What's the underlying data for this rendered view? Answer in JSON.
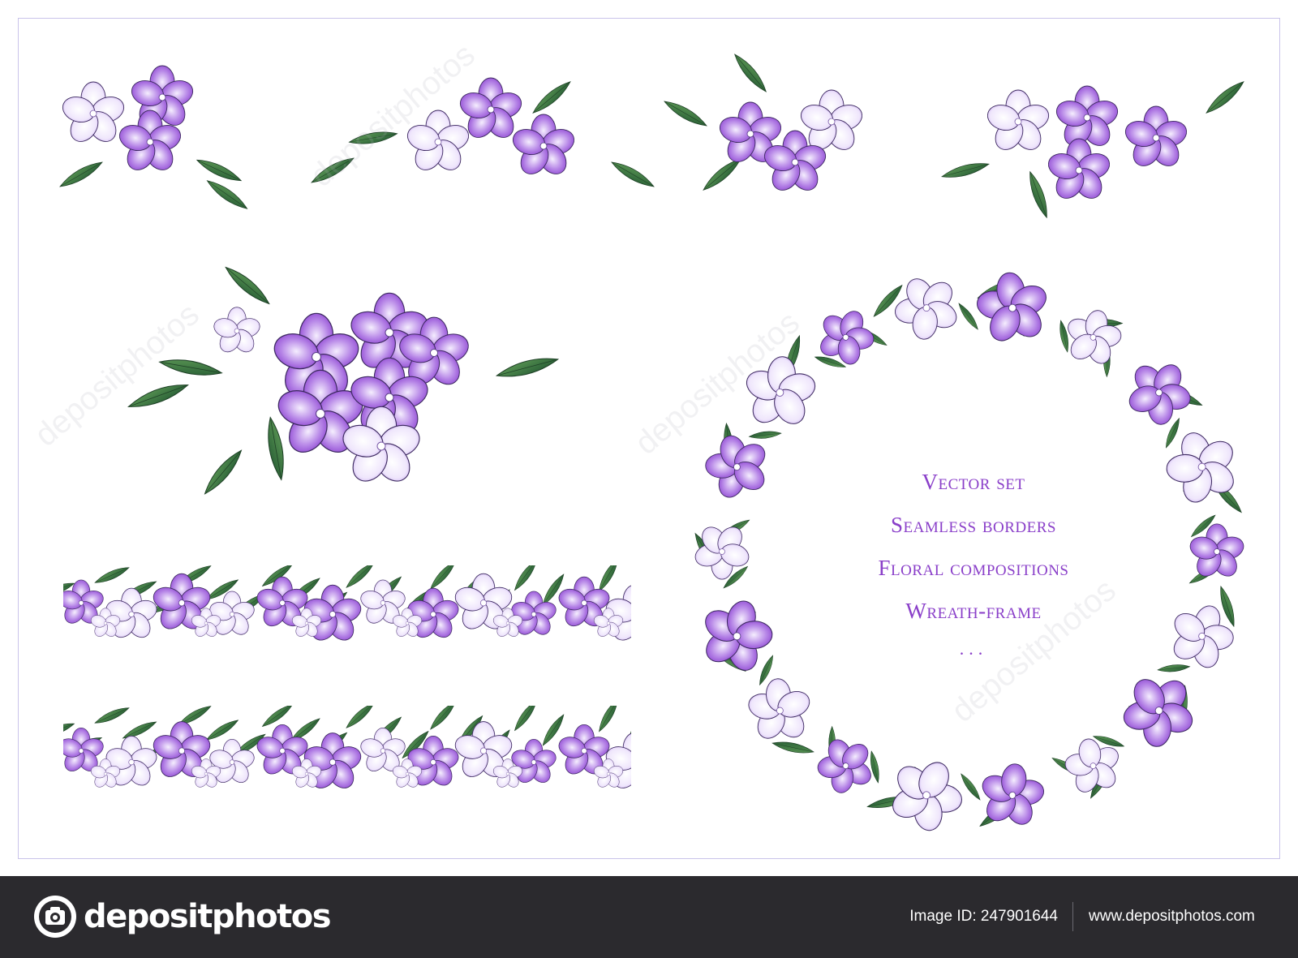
{
  "wreath_text": {
    "line1": "Vector set",
    "line2": "Seamless borders",
    "line3": "Floral compositions",
    "line4": "Wreath-frame",
    "dots": "..."
  },
  "footer": {
    "logo_text": "depositphotos",
    "image_id": "Image ID: 247901644",
    "site": "www.depositphotos.com"
  },
  "watermark": "depositphotos",
  "colors": {
    "violet_dark": "#8a3fd0",
    "violet_light": "#d9c6f4",
    "leaf_dark": "#2f6b3c",
    "leaf_light": "#79c24a",
    "text": "#8a3fc9",
    "footer_bg": "#2b2a2e"
  }
}
